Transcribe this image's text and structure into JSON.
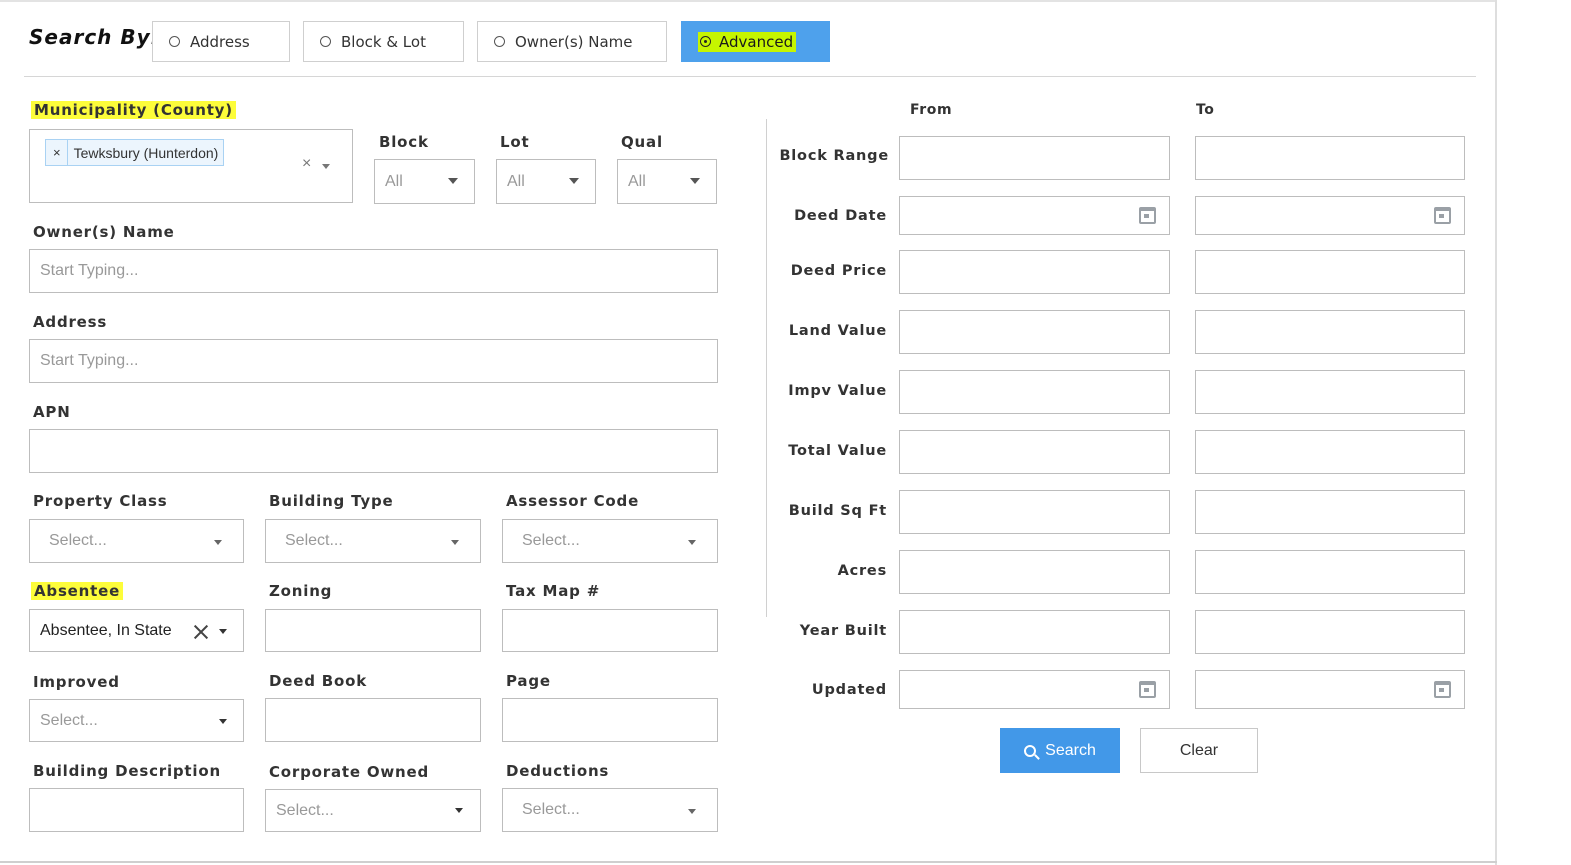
{
  "search_by": {
    "label": "Search By:",
    "options": [
      {
        "label": "Address",
        "selected": false
      },
      {
        "label": "Block & Lot",
        "selected": false
      },
      {
        "label": "Owner(s) Name",
        "selected": false
      },
      {
        "label": "Advanced",
        "selected": true
      }
    ]
  },
  "left": {
    "municipality": {
      "label": "Municipality (County)",
      "chip": "Tewksbury (Hunterdon)",
      "chip_remove": "×",
      "clear": "×"
    },
    "block": {
      "label": "Block",
      "value": "All"
    },
    "lot": {
      "label": "Lot",
      "value": "All"
    },
    "qual": {
      "label": "Qual",
      "value": "All"
    },
    "owner_name": {
      "label": "Owner(s) Name",
      "placeholder": "Start Typing..."
    },
    "address": {
      "label": "Address",
      "placeholder": "Start Typing..."
    },
    "apn": {
      "label": "APN",
      "value": ""
    },
    "property_class": {
      "label": "Property Class",
      "placeholder": "Select..."
    },
    "building_type": {
      "label": "Building Type",
      "placeholder": "Select..."
    },
    "assessor_code": {
      "label": "Assessor Code",
      "placeholder": "Select..."
    },
    "absentee": {
      "label": "Absentee",
      "value": "Absentee, In State"
    },
    "zoning": {
      "label": "Zoning",
      "value": ""
    },
    "tax_map": {
      "label": "Tax Map #",
      "value": ""
    },
    "improved": {
      "label": "Improved",
      "placeholder": "Select..."
    },
    "deed_book": {
      "label": "Deed Book",
      "value": ""
    },
    "page": {
      "label": "Page",
      "value": ""
    },
    "building_description": {
      "label": "Building Description",
      "value": ""
    },
    "corporate_owned": {
      "label": "Corporate Owned",
      "placeholder": "Select..."
    },
    "deductions": {
      "label": "Deductions",
      "placeholder": "Select..."
    }
  },
  "right": {
    "from_header": "From",
    "to_header": "To",
    "rows": [
      {
        "label": "Block Range",
        "type": "text"
      },
      {
        "label": "Deed Date",
        "type": "date"
      },
      {
        "label": "Deed Price",
        "type": "text"
      },
      {
        "label": "Land Value",
        "type": "text"
      },
      {
        "label": "Impv Value",
        "type": "text"
      },
      {
        "label": "Total Value",
        "type": "text"
      },
      {
        "label": "Build Sq Ft",
        "type": "text"
      },
      {
        "label": "Acres",
        "type": "text"
      },
      {
        "label": "Year Built",
        "type": "text"
      },
      {
        "label": "Updated",
        "type": "date"
      }
    ]
  },
  "actions": {
    "search_label": "Search",
    "clear_label": "Clear"
  },
  "colors": {
    "accent": "#4298e8",
    "highlight": "#fdfd3a",
    "active_highlight": "#c6f500"
  }
}
